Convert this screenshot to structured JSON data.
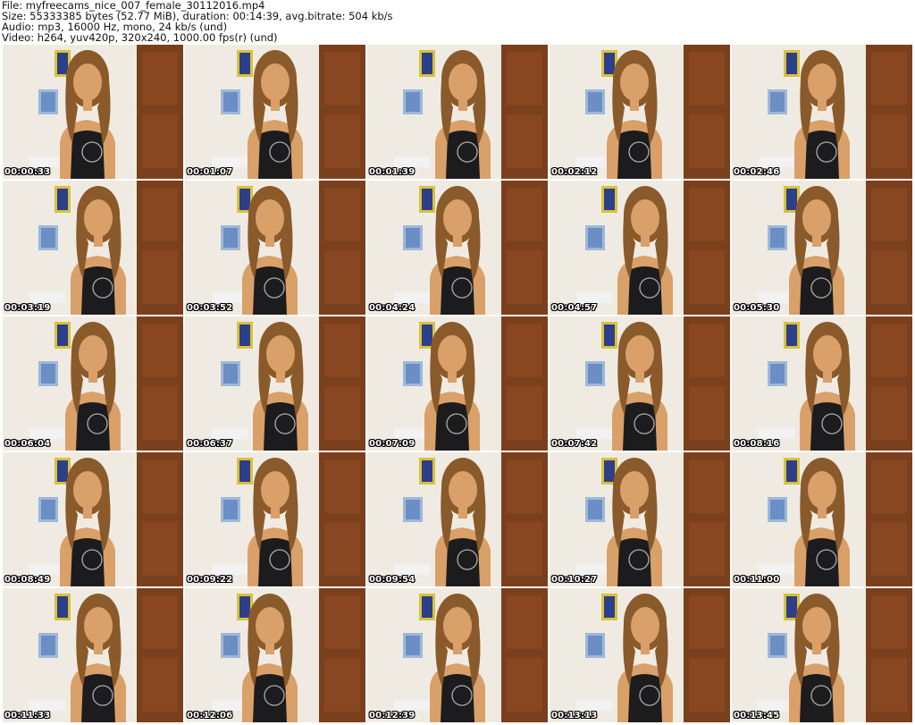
{
  "header": {
    "file_line": "File: myfreecams_nice_007_female_30112016.mp4",
    "size_line": "Size: 55333385 bytes (52.77 MiB), duration: 00:14:39, avg.bitrate: 504 kb/s",
    "audio_line": "Audio: mp3, 16000 Hz, mono, 24 kb/s (und)",
    "video_line": "Video: h264, yuv420p, 320x240, 1000.00 fps(r) (und)"
  },
  "thumbnails": [
    {
      "timestamp": "00:00:33"
    },
    {
      "timestamp": "00:01:07"
    },
    {
      "timestamp": "00:01:39"
    },
    {
      "timestamp": "00:02:12"
    },
    {
      "timestamp": "00:02:46"
    },
    {
      "timestamp": "00:03:19"
    },
    {
      "timestamp": "00:03:52"
    },
    {
      "timestamp": "00:04:24"
    },
    {
      "timestamp": "00:04:57"
    },
    {
      "timestamp": "00:05:30"
    },
    {
      "timestamp": "00:06:04"
    },
    {
      "timestamp": "00:06:37"
    },
    {
      "timestamp": "00:07:09"
    },
    {
      "timestamp": "00:07:42"
    },
    {
      "timestamp": "00:08:16"
    },
    {
      "timestamp": "00:08:49"
    },
    {
      "timestamp": "00:09:22"
    },
    {
      "timestamp": "00:09:54"
    },
    {
      "timestamp": "00:10:27"
    },
    {
      "timestamp": "00:11:00"
    },
    {
      "timestamp": "00:11:33"
    },
    {
      "timestamp": "00:12:06"
    },
    {
      "timestamp": "00:12:39"
    },
    {
      "timestamp": "00:13:13"
    },
    {
      "timestamp": "00:13:45"
    }
  ],
  "colors": {
    "wall": "#e9e3dc",
    "wood": "#7a3f1c",
    "hair": "#8a5a2b",
    "skin": "#d9a06a",
    "shirt": "#1c1c1e"
  }
}
